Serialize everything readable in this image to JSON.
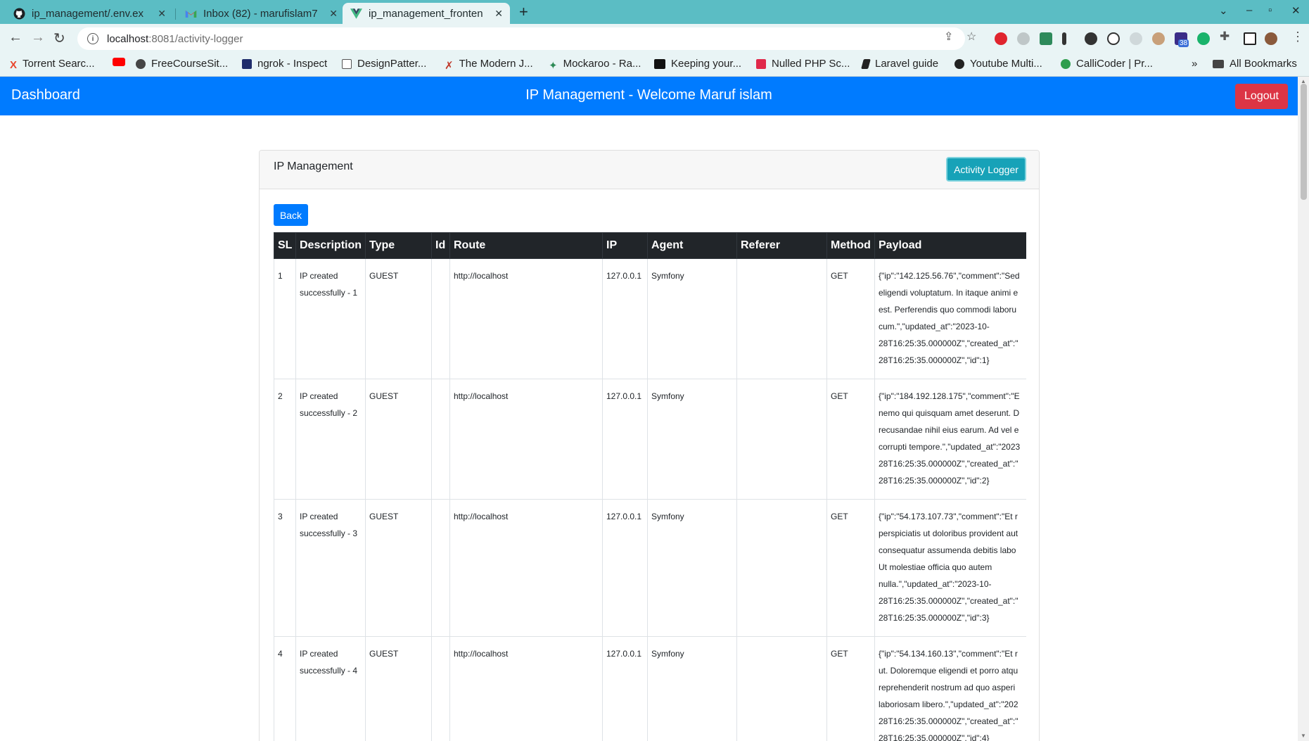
{
  "browser": {
    "tabs": [
      {
        "title": "ip_management/.env.ex",
        "icon": "github-icon"
      },
      {
        "title": "Inbox (82) - marufislam7",
        "icon": "gmail-icon"
      },
      {
        "title": "ip_management_fronten",
        "icon": "vue-icon"
      }
    ],
    "url_host": "localhost",
    "url_path": ":8081/activity-logger",
    "extension_badge": "38",
    "bookmarks": [
      "Torrent Searc...",
      "",
      "FreeCourseSit...",
      "ngrok - Inspect",
      "DesignPatter...",
      "The Modern J...",
      "Mockaroo - Ra...",
      "Keeping your...",
      "Nulled PHP Sc...",
      "Laravel guide",
      "Youtube Multi...",
      "CalliCoder | Pr..."
    ],
    "bookmarks_overflow": "»",
    "all_bookmarks": "All Bookmarks"
  },
  "navbar": {
    "brand": "Dashboard",
    "welcome": "IP Management - Welcome Maruf islam",
    "logout": "Logout"
  },
  "card": {
    "title": "IP Management",
    "activity_logger": "Activity Logger",
    "back": "Back"
  },
  "table": {
    "columns": [
      "SL",
      "Description",
      "Type",
      "Id",
      "Route",
      "IP",
      "Agent",
      "Referer",
      "Method",
      "Payload"
    ],
    "rows": [
      {
        "sl": "1",
        "description": "IP created successfully - 1",
        "type": "GUEST",
        "id": "",
        "route": "http://localhost",
        "ip": "127.0.0.1",
        "agent": "Symfony",
        "referer": "",
        "method": "GET",
        "payload": [
          "{\"ip\":\"142.125.56.76\",\"comment\":\"Sed",
          "eligendi voluptatum. In itaque animi e",
          "est. Perferendis quo commodi laboru",
          "cum.\",\"updated_at\":\"2023-10-",
          "28T16:25:35.000000Z\",\"created_at\":\"",
          "28T16:25:35.000000Z\",\"id\":1}"
        ]
      },
      {
        "sl": "2",
        "description": "IP created successfully - 2",
        "type": "GUEST",
        "id": "",
        "route": "http://localhost",
        "ip": "127.0.0.1",
        "agent": "Symfony",
        "referer": "",
        "method": "GET",
        "payload": [
          "{\"ip\":\"184.192.128.175\",\"comment\":\"E",
          "nemo qui quisquam amet deserunt. D",
          "recusandae nihil eius earum. Ad vel e",
          "corrupti tempore.\",\"updated_at\":\"2023",
          "28T16:25:35.000000Z\",\"created_at\":\"",
          "28T16:25:35.000000Z\",\"id\":2}"
        ]
      },
      {
        "sl": "3",
        "description": "IP created successfully - 3",
        "type": "GUEST",
        "id": "",
        "route": "http://localhost",
        "ip": "127.0.0.1",
        "agent": "Symfony",
        "referer": "",
        "method": "GET",
        "payload": [
          "{\"ip\":\"54.173.107.73\",\"comment\":\"Et r",
          "perspiciatis ut doloribus provident aut",
          "consequatur assumenda debitis labo",
          "Ut molestiae officia quo autem",
          "nulla.\",\"updated_at\":\"2023-10-",
          "28T16:25:35.000000Z\",\"created_at\":\"",
          "28T16:25:35.000000Z\",\"id\":3}"
        ]
      },
      {
        "sl": "4",
        "description": "IP created successfully - 4",
        "type": "GUEST",
        "id": "",
        "route": "http://localhost",
        "ip": "127.0.0.1",
        "agent": "Symfony",
        "referer": "",
        "method": "GET",
        "payload": [
          "{\"ip\":\"54.134.160.13\",\"comment\":\"Et r",
          "ut. Doloremque eligendi et porro atqu",
          "reprehenderit nostrum ad quo asperi",
          "laboriosam libero.\",\"updated_at\":\"202",
          "28T16:25:35.000000Z\",\"created_at\":\"",
          "28T16:25:35.000000Z\",\"id\":4}"
        ]
      }
    ]
  },
  "colors": {
    "navbar": "#007bff",
    "logout": "#dc3545",
    "activity_logger": "#17a2b8",
    "table_header": "#212529",
    "browser_frame": "#5bbdc4"
  }
}
